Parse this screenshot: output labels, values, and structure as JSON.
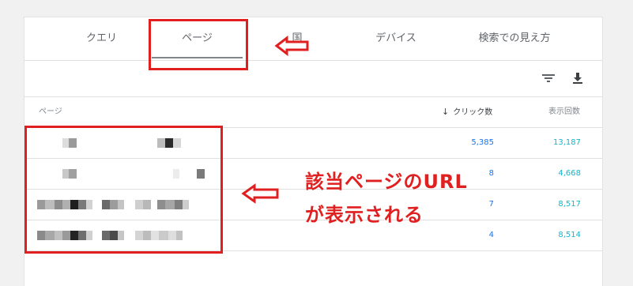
{
  "tabs": [
    {
      "label": "クエリ"
    },
    {
      "label": "ページ"
    },
    {
      "label": "国"
    },
    {
      "label": "デバイス"
    },
    {
      "label": "検索での見え方"
    }
  ],
  "table": {
    "columns": {
      "page": "ページ",
      "clicks": "クリック数",
      "impressions": "表示回数"
    },
    "rows": [
      {
        "clicks": "5,385",
        "impressions": "13,187"
      },
      {
        "clicks": "8",
        "impressions": "4,668"
      },
      {
        "clicks": "7",
        "impressions": "8,517"
      },
      {
        "clicks": "4",
        "impressions": "8,514"
      }
    ]
  },
  "annotation": {
    "line1": "該当ページのURL",
    "line2": "が表示される"
  },
  "colors": {
    "highlight": "#e02020",
    "clicks": "#1a73e8",
    "impressions": "#12b5cb"
  }
}
